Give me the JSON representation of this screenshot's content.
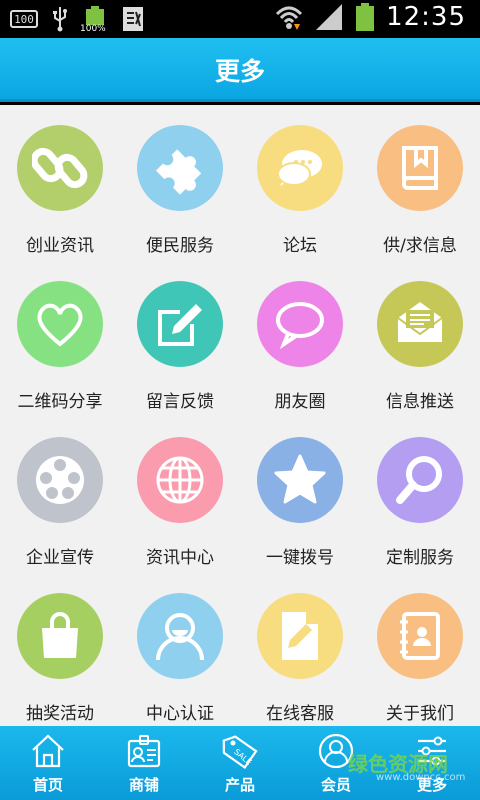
{
  "status_bar": {
    "time": "12:35",
    "box_text": "100",
    "battery_small_pct": "100%"
  },
  "header": {
    "title": "更多"
  },
  "grid": [
    {
      "label": "创业资讯",
      "icon": "link-icon",
      "color": "#b3cf6c"
    },
    {
      "label": "便民服务",
      "icon": "puzzle-icon",
      "color": "#8fd0ee"
    },
    {
      "label": "论坛",
      "icon": "chat-bubbles-icon",
      "color": "#f7dd7f"
    },
    {
      "label": "供/求信息",
      "icon": "book-icon",
      "color": "#f8be82"
    },
    {
      "label": "二维码分享",
      "icon": "heart-icon",
      "color": "#86e182"
    },
    {
      "label": "留言反馈",
      "icon": "edit-icon",
      "color": "#40c6b6"
    },
    {
      "label": "朋友圈",
      "icon": "speech-bubble-icon",
      "color": "#ef84e8"
    },
    {
      "label": "信息推送",
      "icon": "envelope-icon",
      "color": "#c5c756"
    },
    {
      "label": "企业宣传",
      "icon": "film-reel-icon",
      "color": "#bfc3cb"
    },
    {
      "label": "资讯中心",
      "icon": "globe-icon",
      "color": "#fa9cae"
    },
    {
      "label": "一键拨号",
      "icon": "star-icon",
      "color": "#8ab1e6"
    },
    {
      "label": "定制服务",
      "icon": "magnifier-icon",
      "color": "#b39ef1"
    },
    {
      "label": "抽奖活动",
      "icon": "shopping-bag-icon",
      "color": "#a6cf62"
    },
    {
      "label": "中心认证",
      "icon": "user-icon",
      "color": "#8fd0ee"
    },
    {
      "label": "在线客服",
      "icon": "document-pen-icon",
      "color": "#f7dd7f"
    },
    {
      "label": "关于我们",
      "icon": "address-book-icon",
      "color": "#f8be82"
    }
  ],
  "bottom_nav": [
    {
      "label": "首页",
      "icon": "home-icon"
    },
    {
      "label": "商铺",
      "icon": "id-card-icon"
    },
    {
      "label": "产品",
      "icon": "tag-icon"
    },
    {
      "label": "会员",
      "icon": "member-icon"
    },
    {
      "label": "更多",
      "icon": "sliders-icon"
    }
  ],
  "watermark": {
    "text": "绿色资源网",
    "sub": "www.downcc.com"
  }
}
